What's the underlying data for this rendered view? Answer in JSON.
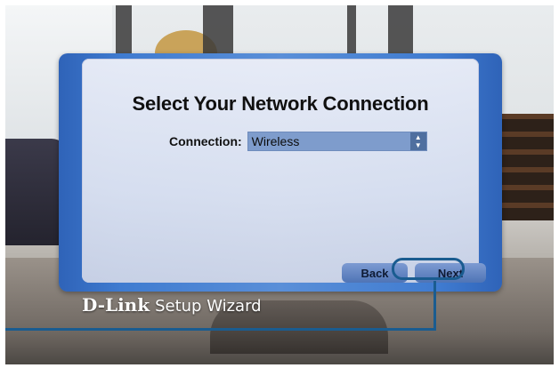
{
  "wizard": {
    "title": "Select Your Network Connection",
    "connection": {
      "label": "Connection:",
      "selected_value": "Wireless",
      "arrows_icon": "up-down-arrows-icon"
    },
    "buttons": {
      "back_label": "Back",
      "next_label": "Next"
    }
  },
  "branding": {
    "logo": "D-Link",
    "subtitle": "Setup Wizard"
  },
  "colors": {
    "frame_blue": "#3f7bd0",
    "panel_bg": "#e6e9f4",
    "select_bg": "#7e9ccc",
    "button_blue": "#5f82c4",
    "callout_blue": "#1a5c90"
  }
}
